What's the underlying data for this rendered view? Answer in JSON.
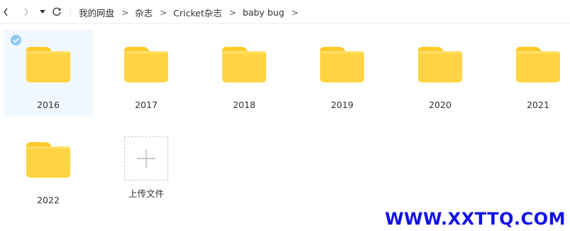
{
  "toolbar": {
    "back_icon": "chevron-left-icon",
    "forward_icon": "chevron-right-icon",
    "history_icon": "caret-down-icon",
    "refresh_icon": "refresh-icon"
  },
  "breadcrumb": {
    "items": [
      "我的网盘",
      "杂志",
      "Cricket杂志",
      "baby bug"
    ],
    "separator": ">"
  },
  "items": [
    {
      "name": "2016",
      "type": "folder",
      "selected": true
    },
    {
      "name": "2017",
      "type": "folder"
    },
    {
      "name": "2018",
      "type": "folder"
    },
    {
      "name": "2019",
      "type": "folder"
    },
    {
      "name": "2020",
      "type": "folder"
    },
    {
      "name": "2021",
      "type": "folder"
    },
    {
      "name": "2022",
      "type": "folder"
    }
  ],
  "upload": {
    "label": "上传文件",
    "icon": "plus-icon"
  },
  "watermark": "WWW.XXTTQ.COM",
  "colors": {
    "folder": "#ffd443",
    "selected_bg": "#f0f7ff",
    "check": "#8fc8f3",
    "watermark": "#1212e6"
  }
}
